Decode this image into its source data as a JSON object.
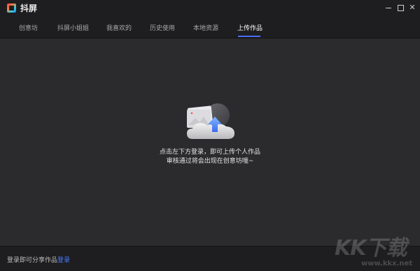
{
  "app": {
    "title": "抖屏"
  },
  "window": {
    "minimize_icon": "minimize-icon",
    "maximize_icon": "maximize-icon",
    "close_icon": "close-icon",
    "close_glyph": "✕"
  },
  "tabs": [
    {
      "label": "创意坊"
    },
    {
      "label": "抖屏小姐姐"
    },
    {
      "label": "我喜欢的"
    },
    {
      "label": "历史使用"
    },
    {
      "label": "本地资源"
    },
    {
      "label": "上传作品",
      "active": true
    }
  ],
  "accent_color": "#4a6cf7",
  "empty_state": {
    "icon": "cloud-upload-icon",
    "line1": "点击左下方登录，即可上传个人作品",
    "line2": "审核通过将会出现在创意坊哦~"
  },
  "footer": {
    "prompt": "登录即可分享作品",
    "login_link": "登录"
  },
  "watermark": {
    "text": "KK下载",
    "url": "www.kkx.net"
  }
}
